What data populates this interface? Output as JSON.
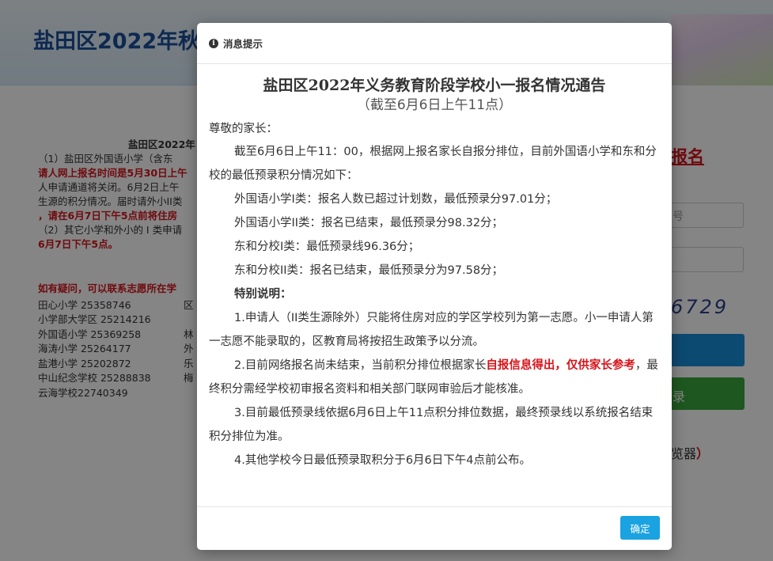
{
  "site": {
    "title": "盐田区2022年秋",
    "notice_title": "盐田区2022年",
    "notice_lines": [
      "（1）盐田区外国语小学（含东",
      "请人网上报名时间是5月30日上午",
      "人申请通道将关闭。6月2日上午",
      "生源的积分情况。届时请外小II类",
      "，请在6月7日下午5点前将住房",
      "（2）其它小学和外小的 I 类申请",
      "6月7日下午5点。"
    ],
    "contacts_head": "如有疑问，可以联系志愿所在学",
    "contacts": [
      [
        "田心小学  25358746",
        "区"
      ],
      [
        "小学部大学区  25214216",
        ""
      ],
      [
        "外国语小学  25369258",
        "林"
      ],
      [
        "海涛小学  25264177",
        "外"
      ],
      [
        "盐港小学  25202872",
        "乐"
      ],
      [
        "中山纪念学校  25288838",
        "梅"
      ],
      [
        "云海学校22740349",
        ""
      ]
    ]
  },
  "right_panel": {
    "title": "报名",
    "input1_placeholder": "号",
    "captcha": "6729",
    "blue_btn": "",
    "green_btn": "录",
    "note": "览器",
    "note_paren": "）"
  },
  "modal": {
    "header_title": "消息提示",
    "doc_title": "盐田区2022年义务教育阶段学校小一报名情况通告",
    "doc_subtitle": "（截至6月6日上午11点）",
    "greeting": "尊敬的家长：",
    "intro": "截至6月6日上午11：00，根据网上报名家长自报分排位，目前外国语小学和东和分校的最低预录积分情况如下：",
    "items": [
      "外国语小学I类：报名人数已超过计划数，最低预录分97.01分；",
      "外国语小学II类：报名已结束，最低预录分98.32分；",
      "东和分校I类：最低预录线96.36分；",
      "东和分校II类：报名已结束，最低预录分为97.58分；"
    ],
    "special_title": "特别说明：",
    "note1": "1.申请人（II类生源除外）只能将住房对应的学区学校列为第一志愿。小一申请人第一志愿不能录取的，区教育局将按招生政策予以分流。",
    "note2_a": "2.目前网络报名尚未结束，当前积分排位根据家长",
    "note2_red": "自报信息得出，仅供家长参考",
    "note2_b": "，最终积分需经学校初审报名资料和相关部门联网审验后才能核准。",
    "note3": "3.目前最低预录线依据6月6日上午11点积分排位数据，最终预录线以系统报名结束积分排位为准。",
    "note4": "4.其他学校今日最低预录取积分于6月6日下午4点前公布。",
    "ok_label": "确定"
  }
}
